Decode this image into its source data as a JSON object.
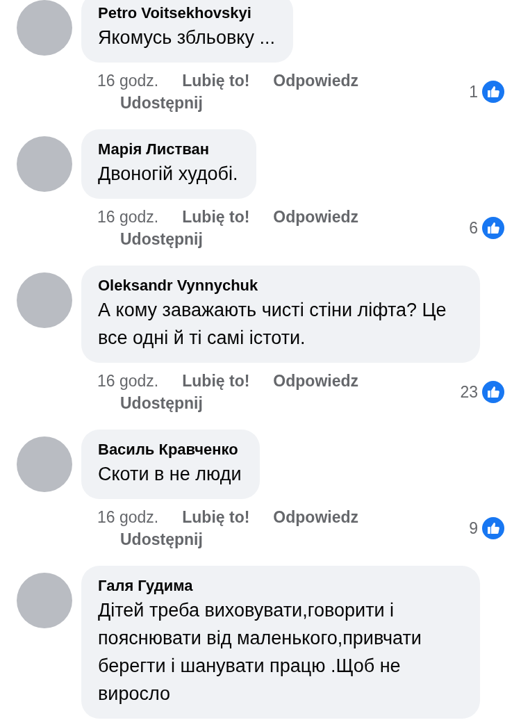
{
  "comments": [
    {
      "author": "Petro Voitsekhovskyi",
      "text": "Якомусь збльовку ...",
      "time": "16 godz.",
      "like": "Lubię to!",
      "reply": "Odpowiedz",
      "share": "Udostępnij",
      "reactions": "1"
    },
    {
      "author": "Марія Листван",
      "text": "Двоногій худобі.",
      "time": "16 godz.",
      "like": "Lubię to!",
      "reply": "Odpowiedz",
      "share": "Udostępnij",
      "reactions": "6"
    },
    {
      "author": "Oleksandr Vynnychuk",
      "text": "А кому заважають чисті стіни ліфта? Це все одні й ті самі істоти.",
      "time": "16 godz.",
      "like": "Lubię to!",
      "reply": "Odpowiedz",
      "share": "Udostępnij",
      "reactions": "23"
    },
    {
      "author": "Василь Кравченко",
      "text": "Скоти в не люди",
      "time": "16 godz.",
      "like": "Lubię to!",
      "reply": "Odpowiedz",
      "share": "Udostępnij",
      "reactions": "9"
    },
    {
      "author": "Галя Гудима",
      "text": "Дітей треба виховувати,говорити і пояснювати від маленького,привчати берегти і шанувати працю .Щоб не виросло"
    }
  ]
}
